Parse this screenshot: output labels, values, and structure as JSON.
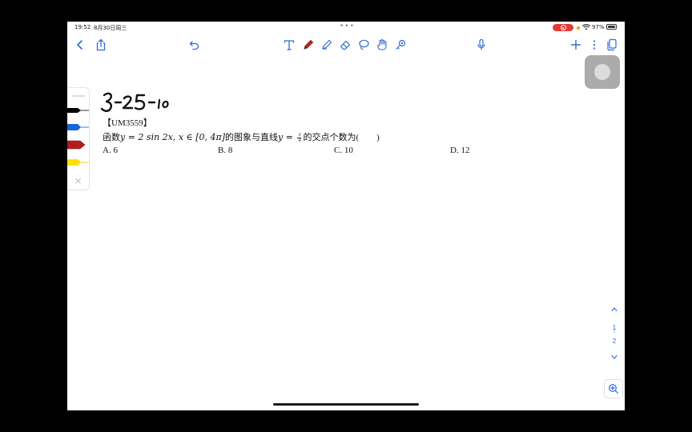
{
  "status_bar": {
    "time": "19:52",
    "date": "8月30日周三",
    "dots": "•••",
    "battery": "97%"
  },
  "toolbar": {
    "left": [
      "back-chevron-icon",
      "share-icon",
      "undo-icon"
    ],
    "tools": [
      "text-tool-icon",
      "pen-icon",
      "highlighter-icon",
      "eraser-icon",
      "lasso-icon",
      "hand-icon",
      "link-icon"
    ],
    "right": [
      "microphone-icon",
      "add-icon",
      "more-icon",
      "pages-icon"
    ]
  },
  "palette": {
    "colors": [
      "#000000",
      "#1565e0",
      "#b71c1c",
      "#ffe000"
    ],
    "close_glyph": "✕"
  },
  "handwriting": {
    "text": "3-25-10"
  },
  "problem": {
    "id": "【UM3559】",
    "question_prefix": "函数",
    "expr_main": "y = 2 sin 2x, x ∈ [0, 4π]",
    "question_mid": "的图象与直线",
    "expr_line_lhs": "y = ",
    "frac_num": "3",
    "frac_den": "4",
    "question_suffix": "的交点个数为(　　)",
    "options": [
      "A. 6",
      "B. 8",
      "C. 10",
      "D. 12"
    ]
  },
  "pager": {
    "current": "1",
    "separator": "/",
    "total": "2"
  },
  "colors": {
    "accent": "#2f6bd8",
    "recording": "#e53935"
  }
}
